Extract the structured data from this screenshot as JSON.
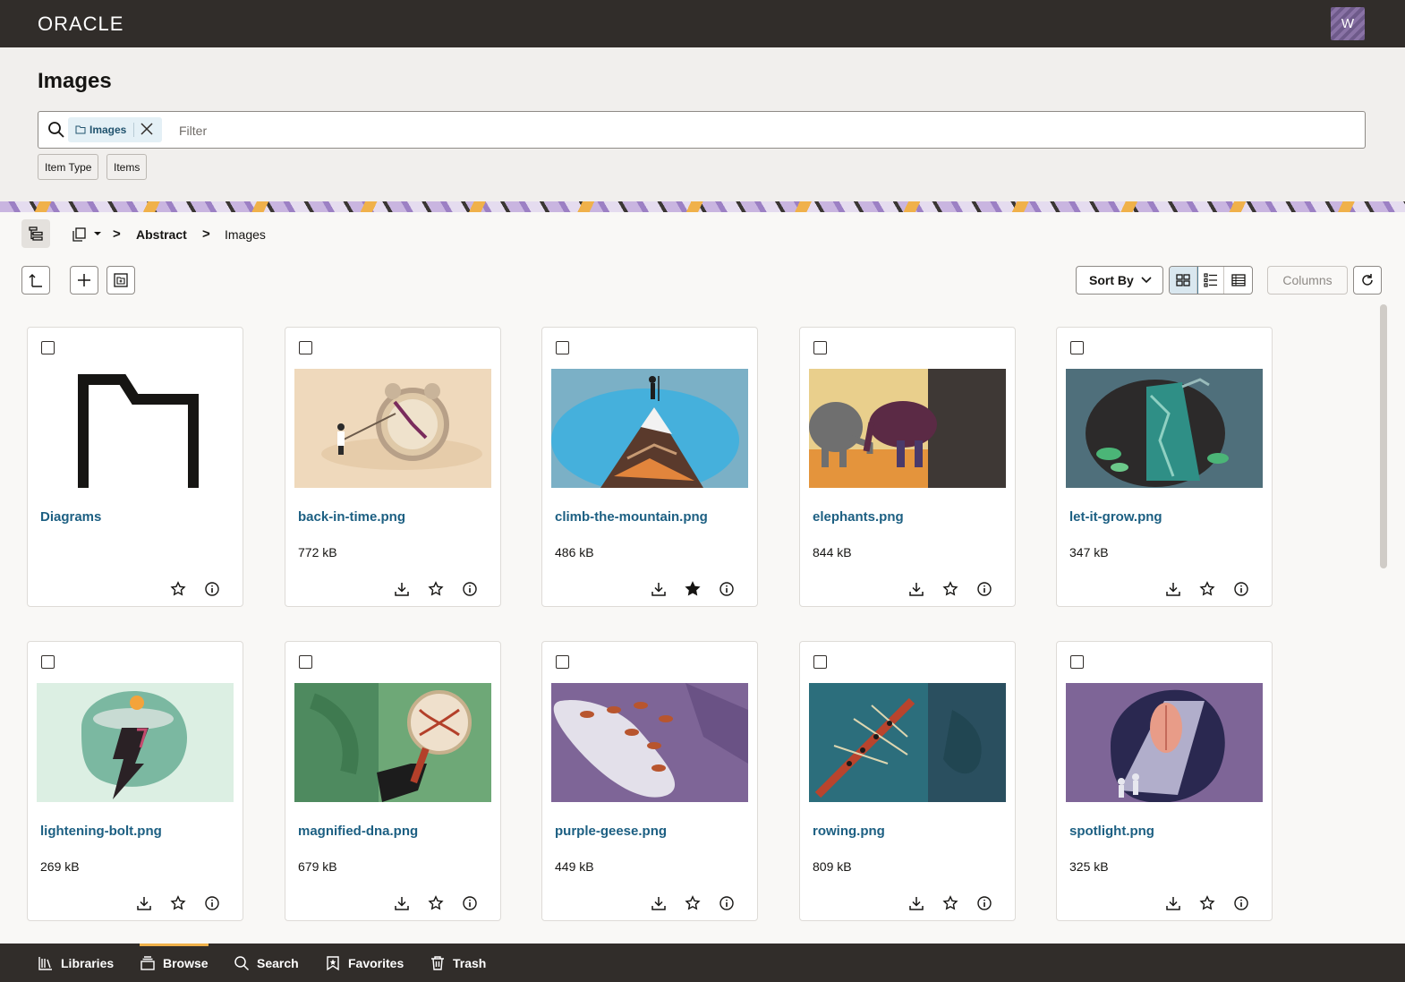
{
  "app": {
    "brand": "ORACLE",
    "user_initial": "W"
  },
  "header": {
    "title": "Images",
    "search": {
      "chip_label": "Images",
      "placeholder": "Filter",
      "value": ""
    },
    "facets": [
      "Item Type",
      "Items"
    ]
  },
  "breadcrumb": {
    "items": [
      "Abstract",
      "Images"
    ],
    "separator": ">"
  },
  "toolbar": {
    "sort_label": "Sort By",
    "columns_label": "Columns"
  },
  "items": [
    {
      "name": "Diagrams",
      "type": "folder",
      "size": "",
      "favorite": false
    },
    {
      "name": "back-in-time.png",
      "type": "image",
      "size": "772 kB",
      "favorite": false
    },
    {
      "name": "climb-the-mountain.png",
      "type": "image",
      "size": "486 kB",
      "favorite": true
    },
    {
      "name": "elephants.png",
      "type": "image",
      "size": "844 kB",
      "favorite": false
    },
    {
      "name": "let-it-grow.png",
      "type": "image",
      "size": "347 kB",
      "favorite": false
    },
    {
      "name": "lightening-bolt.png",
      "type": "image",
      "size": "269 kB",
      "favorite": false
    },
    {
      "name": "magnified-dna.png",
      "type": "image",
      "size": "679 kB",
      "favorite": false
    },
    {
      "name": "purple-geese.png",
      "type": "image",
      "size": "449 kB",
      "favorite": false
    },
    {
      "name": "rowing.png",
      "type": "image",
      "size": "809 kB",
      "favorite": false
    },
    {
      "name": "spotlight.png",
      "type": "image",
      "size": "325 kB",
      "favorite": false
    }
  ],
  "bottom_nav": [
    {
      "label": "Libraries",
      "active": false
    },
    {
      "label": "Browse",
      "active": true
    },
    {
      "label": "Search",
      "active": false
    },
    {
      "label": "Favorites",
      "active": false
    },
    {
      "label": "Trash",
      "active": false
    }
  ],
  "colors": {
    "topbar": "#312d2a",
    "link": "#1c5f82",
    "accent": "#f0b14a"
  }
}
